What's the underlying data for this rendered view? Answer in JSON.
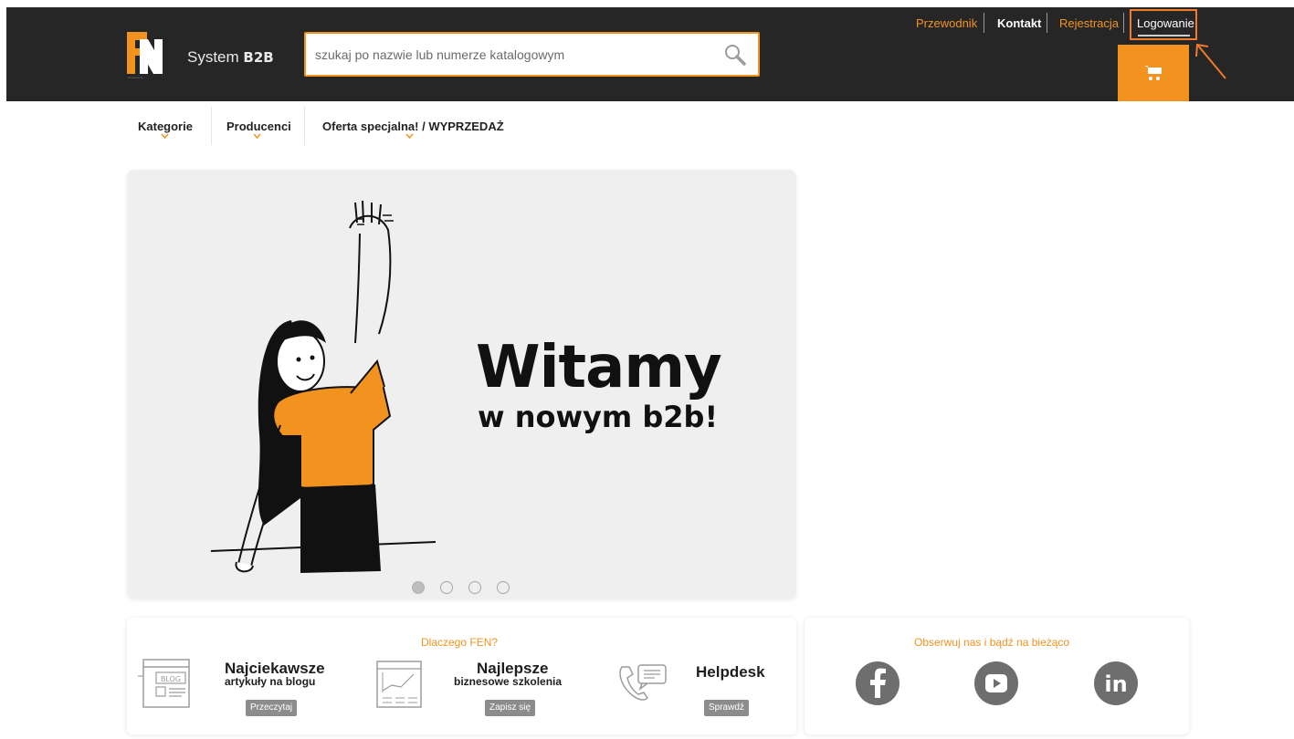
{
  "brand": {
    "logo_text": "FEN",
    "logo_subtext": "komponenty",
    "system_prefix": "System",
    "system_suffix": "B2B"
  },
  "search": {
    "placeholder": "szukaj po nazwie lub numerze katalogowym",
    "value": ""
  },
  "top_links": {
    "guide": "Przewodnik",
    "contact": "Kontakt",
    "register": "Rejestracja",
    "login": "Logowanie"
  },
  "nav": {
    "categories": "Kategorie",
    "producers": "Producenci",
    "special_offer": "Oferta specjalna! / WYPRZEDAŻ"
  },
  "hero": {
    "title": "Witamy",
    "subtitle": "w nowym b2b!",
    "slide_count": 4,
    "active_slide": 1
  },
  "why_fen": {
    "title": "Dlaczego FEN?",
    "features": [
      {
        "title": "Najciekawsze",
        "subtitle": "artykuły na blogu",
        "button": "Przeczytaj",
        "icon": "blog-icon",
        "icon_text": "BLOG"
      },
      {
        "title": "Najlepsze",
        "subtitle": "biznesowe szkolenia",
        "button": "Zapisz się",
        "icon": "training-icon"
      },
      {
        "title": "Helpdesk",
        "subtitle": "",
        "button": "Sprawdź",
        "icon": "phone-chat-icon"
      }
    ]
  },
  "social": {
    "title": "Obserwuj nas i bądź na bieżąco",
    "icons": [
      "facebook-icon",
      "youtube-icon",
      "linkedin-icon"
    ],
    "linkedin_text": "in"
  },
  "colors": {
    "accent": "#f29320",
    "header_bg": "#262626",
    "highlight": "#f07b2b"
  }
}
